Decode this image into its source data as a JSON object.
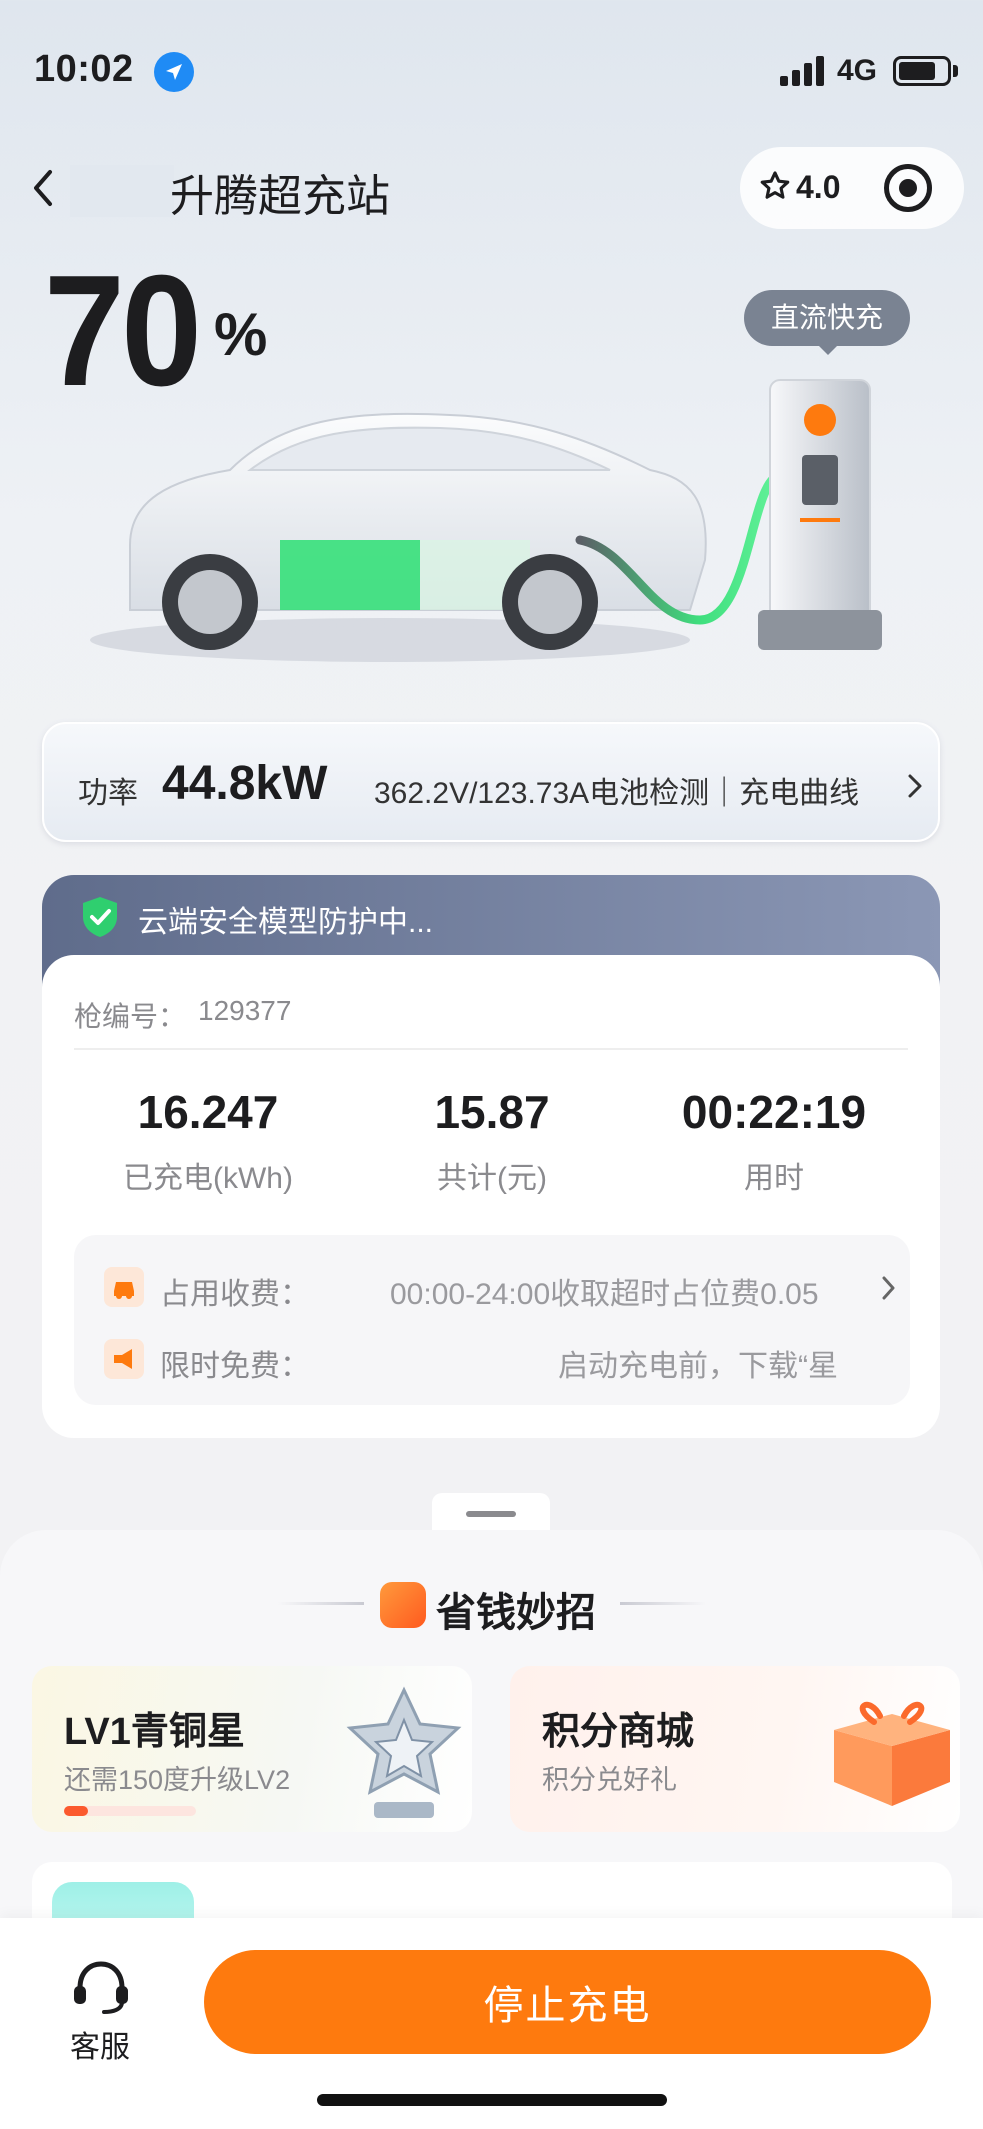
{
  "status_bar": {
    "time": "10:02",
    "network": "4G"
  },
  "header": {
    "title": "升腾超充站",
    "rating": "4.0"
  },
  "hero": {
    "battery_percent": "70",
    "percent_sign": "%",
    "charge_type": "直流快充"
  },
  "power": {
    "label": "功率",
    "value": "44.8kW",
    "detail": "362.2V/123.73A电池检测｜充电曲线"
  },
  "safety": {
    "text": "云端安全模型防护中..."
  },
  "session": {
    "gun_label": "枪编号：",
    "gun_value": "129377",
    "stats": [
      {
        "value": "16.247",
        "label": "已充电(kWh)"
      },
      {
        "value": "15.87",
        "label": "共计(元)"
      },
      {
        "value": "00:22:19",
        "label": "用时"
      }
    ],
    "fees": [
      {
        "label": "占用收费：",
        "text": "00:00-24:00收取超时占位费0.05"
      },
      {
        "label": "限时免费：",
        "text": "启动充电前，下载“星"
      }
    ]
  },
  "savings": {
    "title": "省钱妙招",
    "level_card": {
      "title": "LV1青铜星",
      "subtitle": "还需150度升级LV2",
      "progress": 0.18
    },
    "mall_card": {
      "title": "积分商城",
      "subtitle": "积分兑好礼"
    }
  },
  "action_bar": {
    "service_label": "客服",
    "stop_label": "停止充电"
  },
  "colors": {
    "accent": "#fe7a0e",
    "battery_green": "#36e07a",
    "banner": "#6b7797"
  }
}
